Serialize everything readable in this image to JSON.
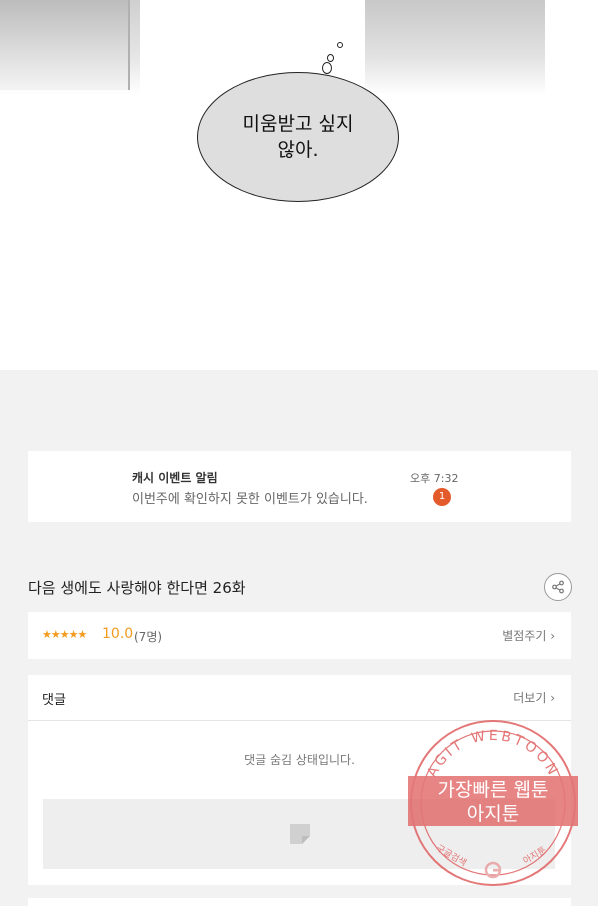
{
  "comic": {
    "bubble_line1": "미움받고 싶지",
    "bubble_line2": "않아."
  },
  "notification": {
    "title": "캐시 이벤트 알림",
    "message": "이번주에 확인하지 못한 이벤트가 있습니다.",
    "time": "오후 7:32",
    "badge_count": "1"
  },
  "episode": {
    "title": "다음 생에도 사랑해야 한다면 26화",
    "share_icon": "share-icon"
  },
  "rating": {
    "stars": "★★★★★",
    "score": "10.0",
    "count": "(7명)",
    "rate_link": "별점주기 ›"
  },
  "comments": {
    "header": "댓글",
    "more_link": "더보기 ›",
    "hidden_message": "댓글 숨김 상태입니다."
  },
  "watermark": {
    "arc_text": "AGIT WEBTOON",
    "line1": "가장빠른 웹툰",
    "line2": "아지툰",
    "bottom_left": "구글검색",
    "bottom_right": "아지툰"
  },
  "colors": {
    "accent_orange": "#f29b1d",
    "badge_red": "#e35b2a",
    "stamp_red": "#e06060"
  }
}
